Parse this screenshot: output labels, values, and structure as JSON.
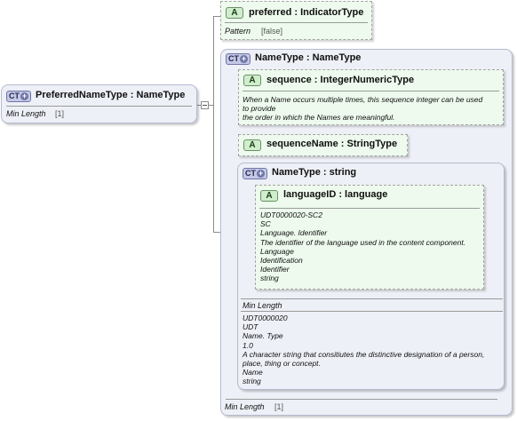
{
  "root": {
    "badge": "CT",
    "title": "PreferredNameType : NameType",
    "prop_label": "Min Length",
    "prop_value": "[1]"
  },
  "preferred": {
    "badge": "A",
    "title": "preferred : IndicatorType",
    "prop_label": "Pattern",
    "prop_value": "[false]"
  },
  "nametype": {
    "badge": "CT",
    "title": "NameType : NameType",
    "prop_label": "Min Length",
    "prop_value": "[1]"
  },
  "sequence": {
    "badge": "A",
    "title": "sequence : IntegerNumericType",
    "doc": "When a Name occurs multiple times, this sequence integer can be used\nto provide\nthe order in which the Names are meaningful."
  },
  "sequencename": {
    "badge": "A",
    "title": "sequenceName : StringType"
  },
  "namestring": {
    "badge": "CT",
    "title": "NameType : string",
    "prop_label": "Min Length",
    "doc": "UDT0000020\nUDT\nName. Type\n1.0\nA character string that consitiutes the distinctive designation of a person,\nplace, thing or concept.\nName\nstring"
  },
  "languageid": {
    "badge": "A",
    "title": "languageID : language",
    "doc": "UDT0000020-SC2\nSC\nLanguage. Identifier\nThe identifier of the language used in the content component.\nLanguage\nIdentification\nIdentifier\nstring"
  },
  "icons": {
    "expand_toggle": "minus-box-icon",
    "complex_type": "complex-type-icon",
    "attribute": "attribute-icon"
  },
  "colors": {
    "complex_type_fill": "#eef0f7",
    "attribute_fill": "#edfaed",
    "connector": "#8c8c8c"
  }
}
